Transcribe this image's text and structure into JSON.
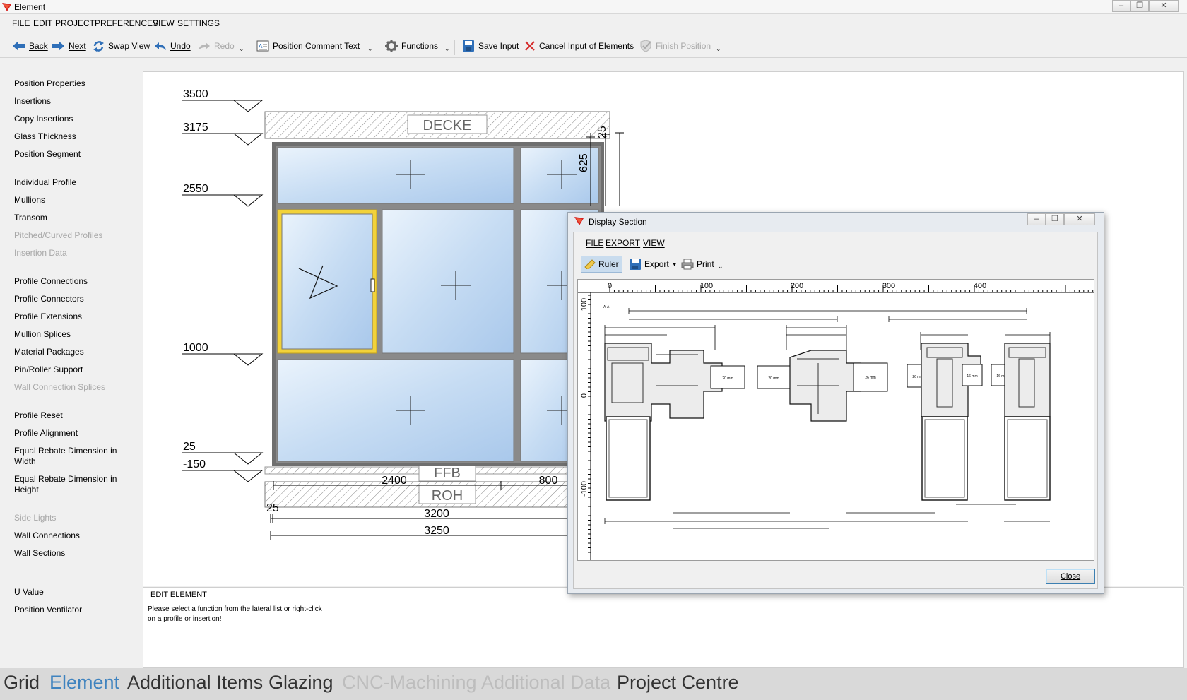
{
  "window": {
    "title": "Element",
    "controls": [
      "minimize-icon",
      "restore-icon",
      "close-icon"
    ]
  },
  "menu": [
    "FILE",
    "EDIT",
    "PROJECT",
    "PREFERENCES",
    "VIEW",
    "SETTINGS"
  ],
  "toolbar": {
    "back": "Back",
    "next": "Next",
    "swap_view": "Swap View",
    "undo": "Undo",
    "redo": "Redo",
    "position_comment_text": "Position Comment Text",
    "functions": "Functions",
    "save_input": "Save Input",
    "cancel_input": "Cancel Input of Elements",
    "finish_position": "Finish Position"
  },
  "sidebar": [
    {
      "label": "Position Properties",
      "enabled": true
    },
    {
      "label": "Insertions",
      "enabled": true
    },
    {
      "label": "Copy Insertions",
      "enabled": true
    },
    {
      "label": "Glass Thickness",
      "enabled": true
    },
    {
      "label": "Position Segment",
      "enabled": true
    },
    {
      "label": "Individual Profile",
      "enabled": true
    },
    {
      "label": "Mullions",
      "enabled": true
    },
    {
      "label": "Transom",
      "enabled": true
    },
    {
      "label": "Pitched/Curved Profiles",
      "enabled": false
    },
    {
      "label": "Insertion Data",
      "enabled": false
    },
    {
      "label": "Profile Connections",
      "enabled": true
    },
    {
      "label": "Profile Connectors",
      "enabled": true
    },
    {
      "label": "Profile Extensions",
      "enabled": true
    },
    {
      "label": "Mullion Splices",
      "enabled": true
    },
    {
      "label": "Material Packages",
      "enabled": true
    },
    {
      "label": "Pin/Roller Support",
      "enabled": true
    },
    {
      "label": "Wall Connection Splices",
      "enabled": false
    },
    {
      "label": "Profile Reset",
      "enabled": true
    },
    {
      "label": "Profile Alignment",
      "enabled": true
    },
    {
      "label": "Equal Rebate Dimension in Width",
      "enabled": true
    },
    {
      "label": "Equal Rebate Dimension in Height",
      "enabled": true
    },
    {
      "label": "Side Lights",
      "enabled": false
    },
    {
      "label": "Wall Connections",
      "enabled": true
    },
    {
      "label": "Wall Sections",
      "enabled": true
    },
    {
      "label": "U Value",
      "enabled": true
    },
    {
      "label": "Position Ventilator",
      "enabled": true
    }
  ],
  "drawing": {
    "levels": [
      "3500",
      "3175",
      "2550",
      "1000",
      "25",
      "-150"
    ],
    "labels": {
      "ceiling": "DECKE",
      "floor_finish": "FFB",
      "raw_floor": "ROH"
    },
    "dims_bottom": [
      "2400",
      "800",
      "25",
      "3200",
      "3250"
    ],
    "dims_right": [
      "25",
      "625"
    ]
  },
  "bottom_panel": {
    "title": "EDIT ELEMENT",
    "message": "Please select a function from the lateral list or right-click on a profile or insertion!"
  },
  "tabs": [
    {
      "label": "Grid",
      "state": "normal"
    },
    {
      "label": "Element",
      "state": "active"
    },
    {
      "label": "Additional Items",
      "state": "normal"
    },
    {
      "label": "Glazing",
      "state": "normal"
    },
    {
      "label": "CNC-Machining",
      "state": "disabled"
    },
    {
      "label": "Additional Data",
      "state": "disabled"
    },
    {
      "label": "Project Centre",
      "state": "normal"
    }
  ],
  "dialog": {
    "title": "Display Section",
    "menu": [
      "FILE",
      "EXPORT",
      "VIEW"
    ],
    "toolbar": {
      "ruler": "Ruler",
      "export": "Export",
      "print": "Print"
    },
    "ruler_top": [
      "0",
      "100",
      "200",
      "300",
      "400"
    ],
    "ruler_left": [
      "100",
      "0",
      "-100"
    ],
    "section_labels": [
      "20 mm",
      "20 mm",
      "26 mm",
      "26 mm",
      "16 mm",
      "16 mm",
      "A-A"
    ],
    "close": "Close"
  },
  "colors": {
    "active_tab": "#3f83bf",
    "glass": "#b9d3ef",
    "sash_highlight": "#f2d23a",
    "frame": "#6f6f6f"
  }
}
